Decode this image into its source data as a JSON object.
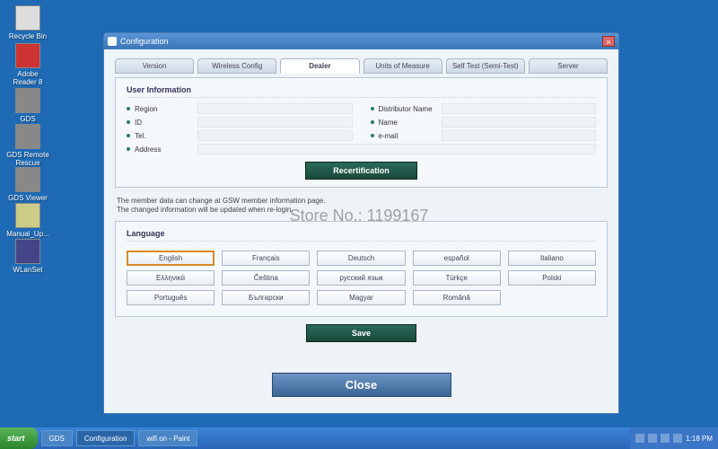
{
  "desktop": {
    "icons": [
      {
        "label": "Recycle Bin"
      },
      {
        "label": "Adobe Reader 8"
      },
      {
        "label": "GDS"
      },
      {
        "label": "GDS Remote Rescue"
      },
      {
        "label": "GDS Viewer"
      },
      {
        "label": "Manual_Up..."
      },
      {
        "label": "WLanSet"
      }
    ]
  },
  "window": {
    "title": "Configuration",
    "tabs": [
      "Version",
      "Wireless Config",
      "Dealer",
      "Units of Measure",
      "Self Test (Semi-Test)",
      "Server"
    ],
    "active_tab": 2,
    "user_info": {
      "title": "User Information",
      "f_region": "Region",
      "f_dist": "Distributor Name",
      "f_id": "ID",
      "f_name": "Name",
      "f_tel": "Tel.",
      "f_email": "e-mail",
      "f_address": "Address"
    },
    "recert_btn": "Recertification",
    "note1": "The member data can change at GSW member information page.",
    "note2": "The changed information will be updated when re-login.",
    "language": {
      "title": "Language",
      "options": [
        "English",
        "Français",
        "Deutsch",
        "español",
        "Italiano",
        "Ελληνικά",
        "Čeština",
        "русский язык",
        "Türkçe",
        "Polski",
        "Português",
        "Български",
        "Magyar",
        "Română"
      ],
      "selected": 0
    },
    "save_btn": "Save",
    "close_btn": "Close"
  },
  "taskbar": {
    "start": "start",
    "items": [
      "GDS",
      "Configuration",
      "wifi on - Paint"
    ],
    "active_item": 1,
    "time": "1:18 PM"
  },
  "watermark": "Store No.: 1199167"
}
